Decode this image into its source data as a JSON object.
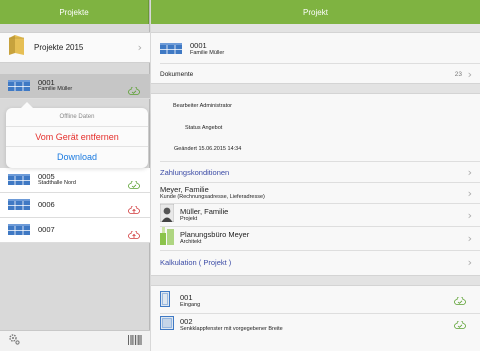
{
  "left": {
    "title": "Projekte",
    "folder": {
      "label": "Projekte 2015"
    },
    "projects": [
      {
        "number": "0001",
        "name": "Familie Müller",
        "cloud": "cloud-check-icon",
        "selected": true
      },
      {
        "number": "0005",
        "name": "Stadthalle Nord",
        "cloud": "cloud-check-icon"
      },
      {
        "number": "0006",
        "name": "",
        "cloud": "cloud-upload-icon"
      },
      {
        "number": "0007",
        "name": "",
        "cloud": "cloud-upload-icon"
      }
    ],
    "popover": {
      "title": "Offline Daten",
      "remove": "Vom Gerät entfernen",
      "download": "Download"
    }
  },
  "right": {
    "title": "Projekt",
    "header": {
      "number": "0001",
      "name": "Familie Müller"
    },
    "documents": {
      "label": "Dokumente",
      "count": "23"
    },
    "info": {
      "editor": "Bearbeiter Administrator",
      "status": "Status  Angebot",
      "changed": "Geändert  15.06.2015 14:34"
    },
    "links": {
      "payment": "Zahlungskonditionen",
      "calc": "Kalkulation ( Projekt )"
    },
    "contacts": [
      {
        "name": "Meyer, Familie",
        "role": "Kunde (Rechnungsadresse, Lieferadresse)"
      },
      {
        "name": "Müller, Familie",
        "role": "Projekt"
      },
      {
        "name": "Planungsbüro Meyer",
        "role": "Architekt"
      }
    ],
    "positions": [
      {
        "number": "001",
        "name": "Eingang"
      },
      {
        "number": "002",
        "name": "Senkklappfenster mit vorgegebener Breite"
      }
    ]
  },
  "colors": {
    "accent": "#7fb341",
    "link": "#3b4ba6",
    "danger": "#e5302d",
    "action": "#1a7ae0"
  }
}
